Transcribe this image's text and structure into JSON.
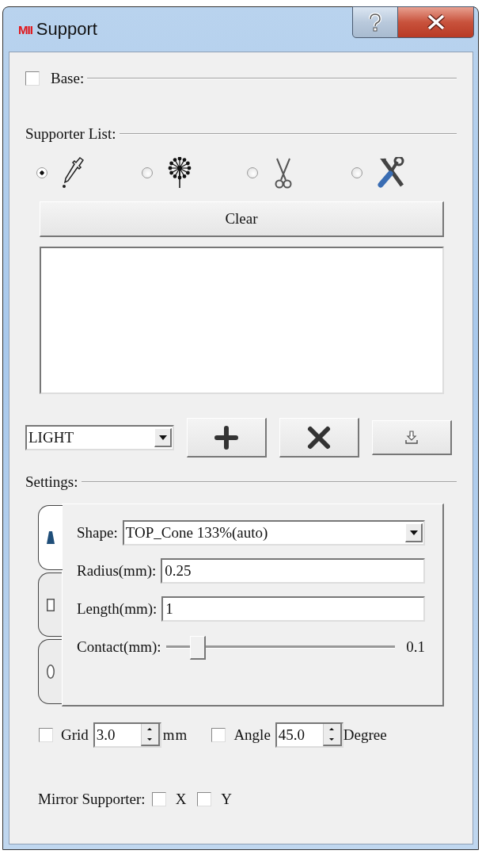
{
  "window": {
    "logo": "MII",
    "title": "Support"
  },
  "base": {
    "label": "Base:",
    "checked": false
  },
  "supporter_list": {
    "label": "Supporter List:",
    "tools": [
      {
        "kind": "dropper",
        "selected": true
      },
      {
        "kind": "dandelion",
        "selected": false
      },
      {
        "kind": "scissors",
        "selected": false
      },
      {
        "kind": "tools",
        "selected": false
      }
    ]
  },
  "clear_button": "Clear",
  "profile": {
    "value": "LIGHT"
  },
  "actions": [
    {
      "kind": "add"
    },
    {
      "kind": "delete"
    },
    {
      "kind": "export"
    }
  ],
  "settings": {
    "label": "Settings:",
    "tabs": [
      {
        "kind": "cone",
        "selected": true
      },
      {
        "kind": "square",
        "selected": false
      },
      {
        "kind": "oval",
        "selected": false
      }
    ],
    "shape": {
      "label": "Shape:",
      "value": "TOP_Cone 133%(auto)"
    },
    "radius": {
      "label": "Radius(mm):",
      "value": "0.25"
    },
    "length": {
      "label": "Length(mm):",
      "value": "1"
    },
    "contact": {
      "label": "Contact(mm):",
      "level": 0.14,
      "reading": "0.1"
    }
  },
  "grid": {
    "checked": false,
    "label": "Grid",
    "value": "3.0",
    "unit": "mm"
  },
  "angle": {
    "checked": false,
    "label": "Angle",
    "value": "45.0",
    "unit": "Degree"
  },
  "mirror": {
    "label": "Mirror Supporter:",
    "options": [
      {
        "label": "X",
        "checked": false
      },
      {
        "label": "Y",
        "checked": false
      }
    ]
  }
}
